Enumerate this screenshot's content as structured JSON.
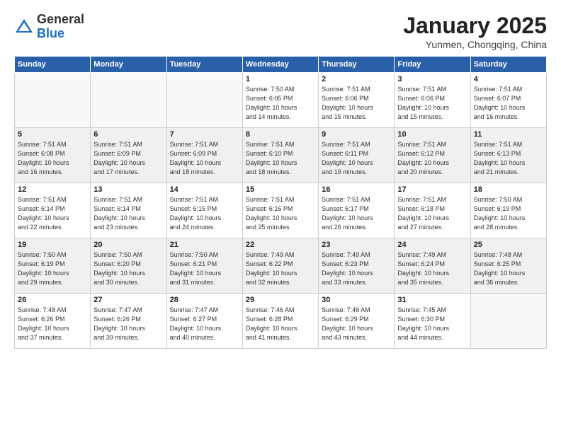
{
  "header": {
    "logo_general": "General",
    "logo_blue": "Blue",
    "month_title": "January 2025",
    "subtitle": "Yunmen, Chongqing, China"
  },
  "weekdays": [
    "Sunday",
    "Monday",
    "Tuesday",
    "Wednesday",
    "Thursday",
    "Friday",
    "Saturday"
  ],
  "weeks": [
    [
      {
        "num": "",
        "info": ""
      },
      {
        "num": "",
        "info": ""
      },
      {
        "num": "",
        "info": ""
      },
      {
        "num": "1",
        "info": "Sunrise: 7:50 AM\nSunset: 6:05 PM\nDaylight: 10 hours\nand 14 minutes."
      },
      {
        "num": "2",
        "info": "Sunrise: 7:51 AM\nSunset: 6:06 PM\nDaylight: 10 hours\nand 15 minutes."
      },
      {
        "num": "3",
        "info": "Sunrise: 7:51 AM\nSunset: 6:06 PM\nDaylight: 10 hours\nand 15 minutes."
      },
      {
        "num": "4",
        "info": "Sunrise: 7:51 AM\nSunset: 6:07 PM\nDaylight: 10 hours\nand 16 minutes."
      }
    ],
    [
      {
        "num": "5",
        "info": "Sunrise: 7:51 AM\nSunset: 6:08 PM\nDaylight: 10 hours\nand 16 minutes."
      },
      {
        "num": "6",
        "info": "Sunrise: 7:51 AM\nSunset: 6:09 PM\nDaylight: 10 hours\nand 17 minutes."
      },
      {
        "num": "7",
        "info": "Sunrise: 7:51 AM\nSunset: 6:09 PM\nDaylight: 10 hours\nand 18 minutes."
      },
      {
        "num": "8",
        "info": "Sunrise: 7:51 AM\nSunset: 6:10 PM\nDaylight: 10 hours\nand 18 minutes."
      },
      {
        "num": "9",
        "info": "Sunrise: 7:51 AM\nSunset: 6:11 PM\nDaylight: 10 hours\nand 19 minutes."
      },
      {
        "num": "10",
        "info": "Sunrise: 7:51 AM\nSunset: 6:12 PM\nDaylight: 10 hours\nand 20 minutes."
      },
      {
        "num": "11",
        "info": "Sunrise: 7:51 AM\nSunset: 6:13 PM\nDaylight: 10 hours\nand 21 minutes."
      }
    ],
    [
      {
        "num": "12",
        "info": "Sunrise: 7:51 AM\nSunset: 6:14 PM\nDaylight: 10 hours\nand 22 minutes."
      },
      {
        "num": "13",
        "info": "Sunrise: 7:51 AM\nSunset: 6:14 PM\nDaylight: 10 hours\nand 23 minutes."
      },
      {
        "num": "14",
        "info": "Sunrise: 7:51 AM\nSunset: 6:15 PM\nDaylight: 10 hours\nand 24 minutes."
      },
      {
        "num": "15",
        "info": "Sunrise: 7:51 AM\nSunset: 6:16 PM\nDaylight: 10 hours\nand 25 minutes."
      },
      {
        "num": "16",
        "info": "Sunrise: 7:51 AM\nSunset: 6:17 PM\nDaylight: 10 hours\nand 26 minutes."
      },
      {
        "num": "17",
        "info": "Sunrise: 7:51 AM\nSunset: 6:18 PM\nDaylight: 10 hours\nand 27 minutes."
      },
      {
        "num": "18",
        "info": "Sunrise: 7:50 AM\nSunset: 6:19 PM\nDaylight: 10 hours\nand 28 minutes."
      }
    ],
    [
      {
        "num": "19",
        "info": "Sunrise: 7:50 AM\nSunset: 6:19 PM\nDaylight: 10 hours\nand 29 minutes."
      },
      {
        "num": "20",
        "info": "Sunrise: 7:50 AM\nSunset: 6:20 PM\nDaylight: 10 hours\nand 30 minutes."
      },
      {
        "num": "21",
        "info": "Sunrise: 7:50 AM\nSunset: 6:21 PM\nDaylight: 10 hours\nand 31 minutes."
      },
      {
        "num": "22",
        "info": "Sunrise: 7:49 AM\nSunset: 6:22 PM\nDaylight: 10 hours\nand 32 minutes."
      },
      {
        "num": "23",
        "info": "Sunrise: 7:49 AM\nSunset: 6:23 PM\nDaylight: 10 hours\nand 33 minutes."
      },
      {
        "num": "24",
        "info": "Sunrise: 7:49 AM\nSunset: 6:24 PM\nDaylight: 10 hours\nand 35 minutes."
      },
      {
        "num": "25",
        "info": "Sunrise: 7:48 AM\nSunset: 6:25 PM\nDaylight: 10 hours\nand 36 minutes."
      }
    ],
    [
      {
        "num": "26",
        "info": "Sunrise: 7:48 AM\nSunset: 6:26 PM\nDaylight: 10 hours\nand 37 minutes."
      },
      {
        "num": "27",
        "info": "Sunrise: 7:47 AM\nSunset: 6:26 PM\nDaylight: 10 hours\nand 39 minutes."
      },
      {
        "num": "28",
        "info": "Sunrise: 7:47 AM\nSunset: 6:27 PM\nDaylight: 10 hours\nand 40 minutes."
      },
      {
        "num": "29",
        "info": "Sunrise: 7:46 AM\nSunset: 6:28 PM\nDaylight: 10 hours\nand 41 minutes."
      },
      {
        "num": "30",
        "info": "Sunrise: 7:46 AM\nSunset: 6:29 PM\nDaylight: 10 hours\nand 43 minutes."
      },
      {
        "num": "31",
        "info": "Sunrise: 7:45 AM\nSunset: 6:30 PM\nDaylight: 10 hours\nand 44 minutes."
      },
      {
        "num": "",
        "info": ""
      }
    ]
  ]
}
